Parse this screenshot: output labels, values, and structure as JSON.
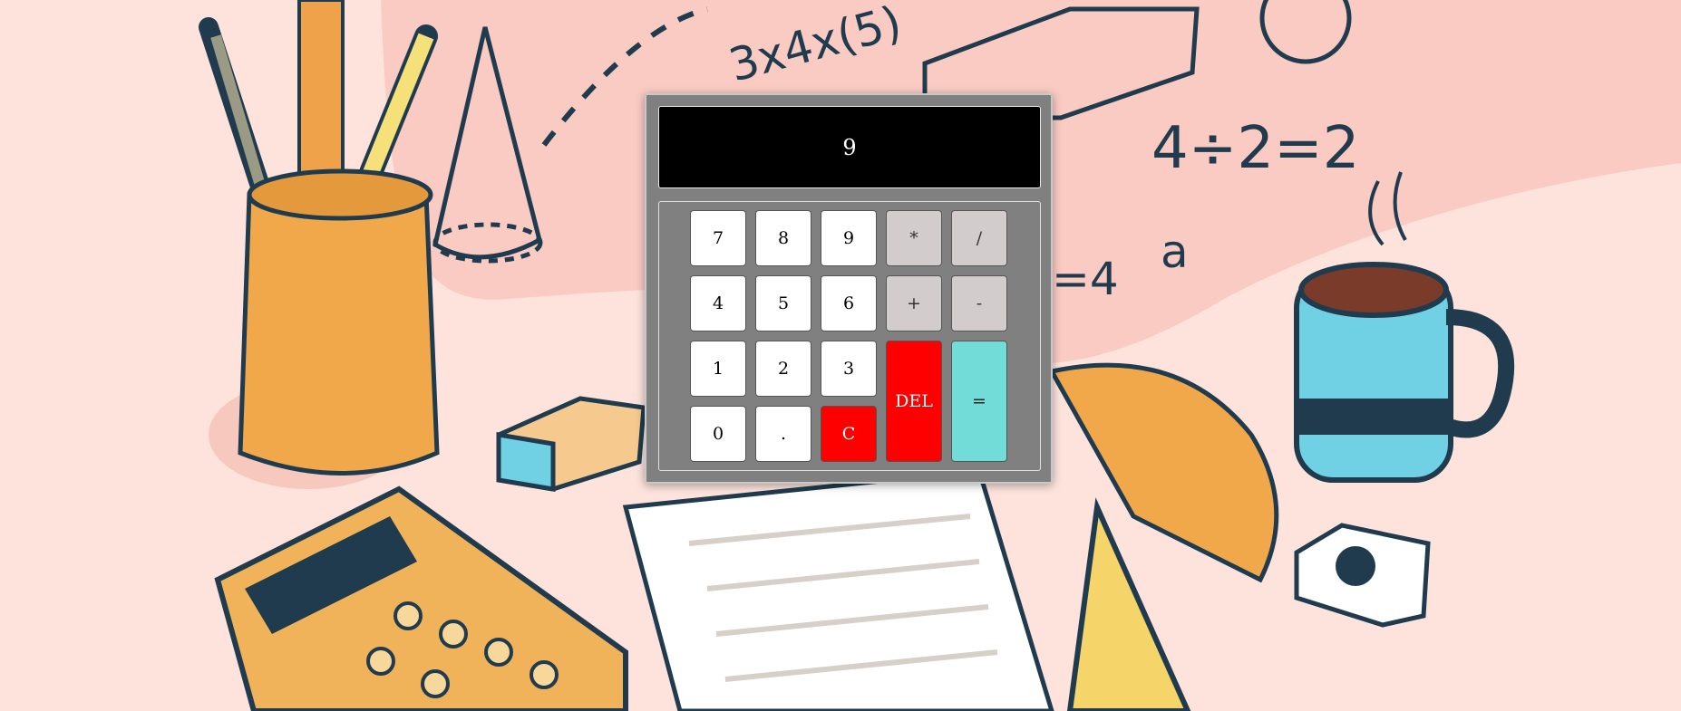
{
  "display": {
    "value": "9"
  },
  "keys": {
    "k7": "7",
    "k8": "8",
    "k9": "9",
    "mul": "*",
    "div": "/",
    "k4": "4",
    "k5": "5",
    "k6": "6",
    "add": "+",
    "sub": "-",
    "k1": "1",
    "k2": "2",
    "k3": "3",
    "del": "DEL",
    "eq": "=",
    "k0": "0",
    "dot": ".",
    "clear": "C"
  },
  "background": {
    "formula_1": "4÷2=2",
    "formula_2": "=4",
    "formula_3": "3x4x(5)",
    "formula_4": "a"
  },
  "colors": {
    "display_bg": "#000000",
    "body_bg": "#808080",
    "red_keys": "#ff0000",
    "equals_key": "#72dcd8",
    "operator_keys": "#d3cccc"
  }
}
